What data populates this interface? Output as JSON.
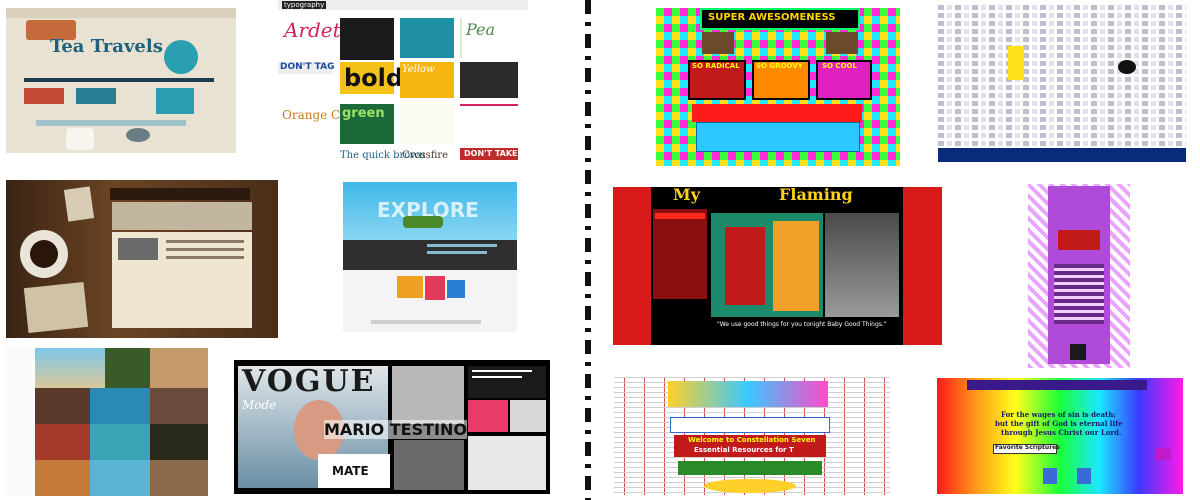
{
  "left_thumbs": {
    "tea_travels": {
      "title": "Tea Travels"
    },
    "typography": {
      "header": "typography",
      "tiles": [
        "Ardet",
        "bold",
        "DON'T TAG",
        "green",
        "Orange Ch",
        "Pea",
        "Yellow",
        "The quick brown",
        "Crossfire",
        "DON'T TAKE"
      ]
    },
    "explore": {
      "title": "EXPLORE"
    },
    "vogue": {
      "logo": "VOGUE",
      "mode": "Mode",
      "mario": "MARIO TESTINO",
      "mate": "MATE"
    }
  },
  "right_thumbs": {
    "super_awesome": {
      "title": "SUPER AWESOMENESS",
      "labels": [
        "SO RADICAL",
        "SO GROOVY",
        "SO COOL"
      ]
    },
    "flaming": {
      "title_part1": "My",
      "title_part2": "Flaming",
      "caption": "\"We use good things for you tonight Baby Good Things.\""
    },
    "constellation": {
      "line1": "Welcome to Constellation Seven",
      "line2": "Essential Resources for T"
    },
    "rainbow": {
      "line1": "For the wages of sin is death;",
      "line2": "but the gift of God is eternal life",
      "line3": "through Jesus Christ our Lord.",
      "button": "Favorite Scriptures"
    }
  },
  "colors": {
    "divider": "#111111",
    "vogue_bg": "#000000",
    "flaming_bg": "#000000"
  }
}
